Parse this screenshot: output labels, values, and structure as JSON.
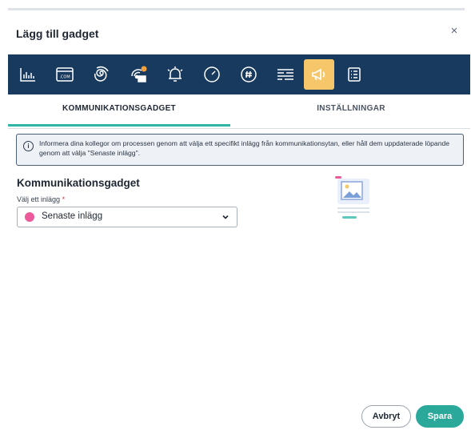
{
  "dialog": {
    "title": "Lägg till gadget",
    "close_label": "×"
  },
  "toolbar": {
    "items": [
      {
        "icon": "bar-chart-icon",
        "active": false
      },
      {
        "icon": "web-domain-icon",
        "active": false
      },
      {
        "icon": "spiral-icon",
        "active": false
      },
      {
        "icon": "network-badge-icon",
        "active": false
      },
      {
        "icon": "bell-alarm-icon",
        "active": false
      },
      {
        "icon": "speedometer-icon",
        "active": false
      },
      {
        "icon": "hashtag-icon",
        "active": false
      },
      {
        "icon": "text-lines-icon",
        "active": false
      },
      {
        "icon": "megaphone-icon",
        "active": true
      },
      {
        "icon": "checklist-icon",
        "active": false
      }
    ],
    "bg_color": "#183a5e",
    "active_color": "#f6c66b"
  },
  "tabs": [
    {
      "label": "KOMMUNIKATIONSGADGET",
      "active": true
    },
    {
      "label": "INSTÄLLNINGAR",
      "active": false
    }
  ],
  "info": {
    "icon": "info-icon",
    "text": "Informera dina kollegor om processen genom att välja ett specifikt inlägg från kommunikationsytan, eller håll dem uppdaterade löpande genom att välja \"Senaste inlägg\"."
  },
  "form": {
    "section_title": "Kommunikationsgadget",
    "field_label": "Välj ett inlägg",
    "required_mark": "*",
    "selected_value": "Senaste inlägg",
    "selected_dot_color": "#ec5a9c"
  },
  "footer": {
    "cancel_label": "Avbryt",
    "save_label": "Spara",
    "accent_color": "#2aa89a"
  }
}
